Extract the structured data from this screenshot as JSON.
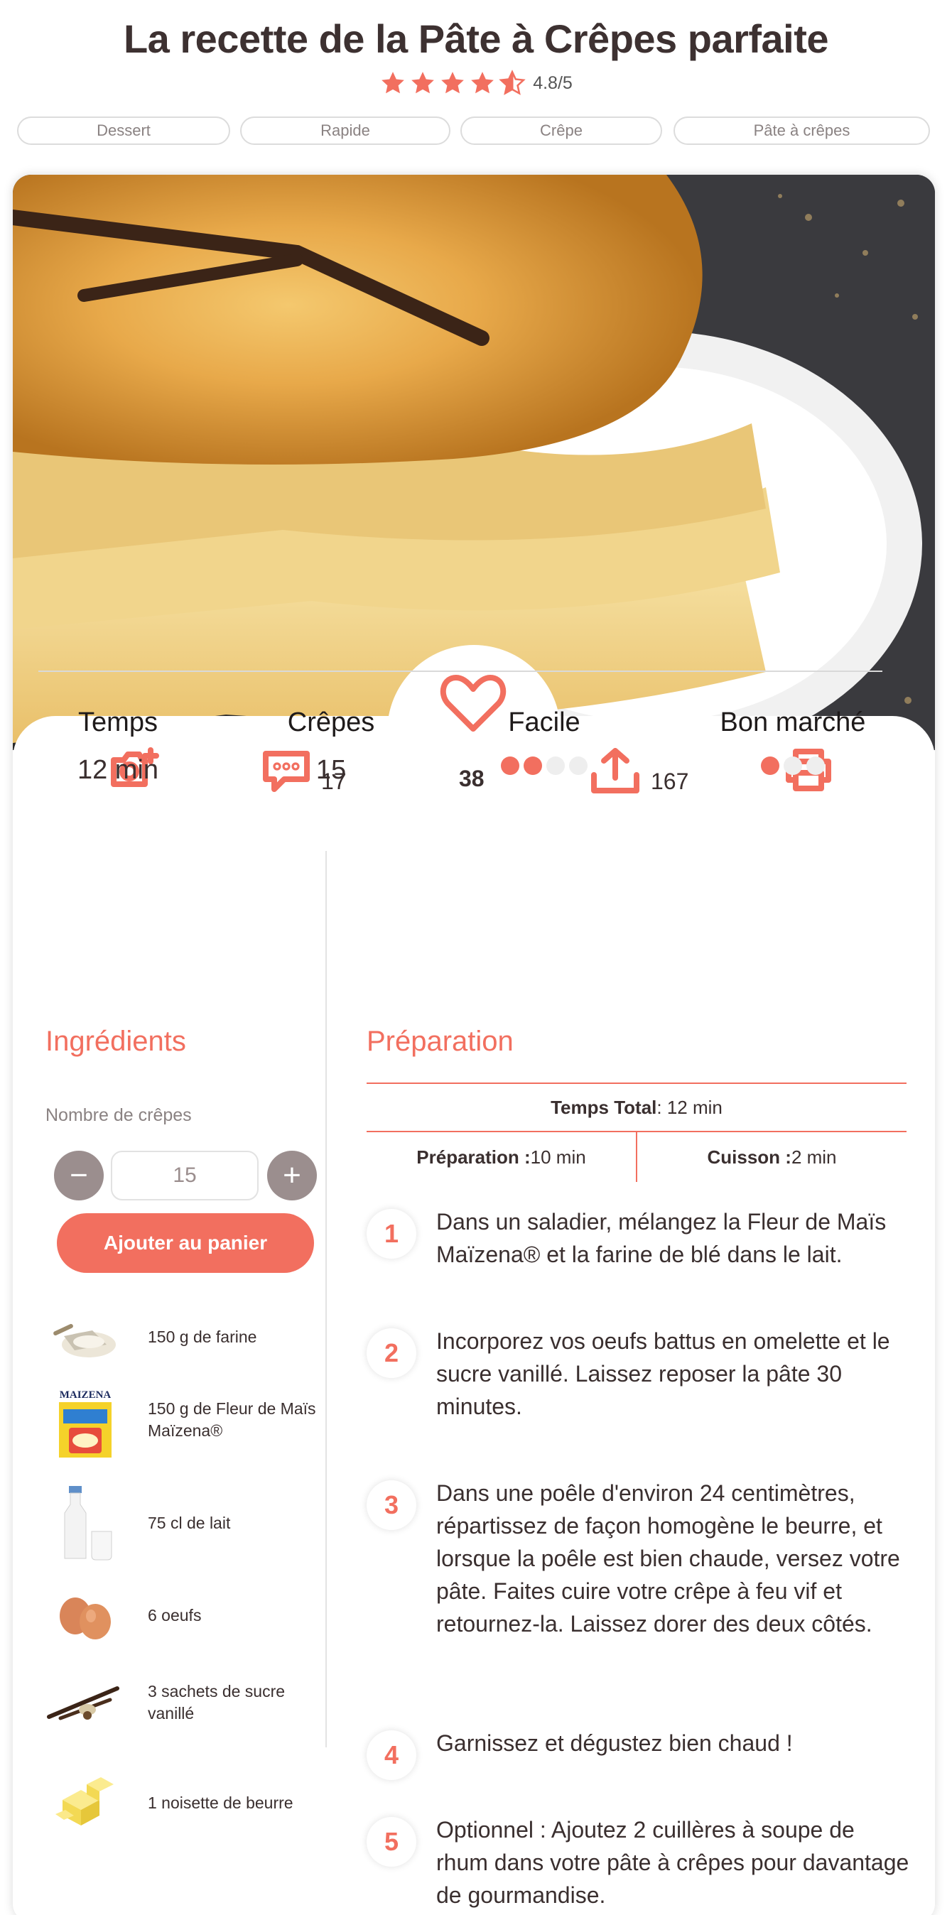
{
  "header": {
    "title": "La recette de la Pâte à Crêpes parfaite",
    "rating": 4.8,
    "rating_text": "4.8/5"
  },
  "tags": [
    "Dessert",
    "Rapide",
    "Crêpe",
    "Pâte à crêpes"
  ],
  "actions": {
    "comments_count": "17",
    "likes_count": "38",
    "shares_count": "167"
  },
  "stats": {
    "time_label": "Temps",
    "time_value": "12 min",
    "yield_label": "Crêpes",
    "yield_value": "15",
    "difficulty_label": "Facile",
    "difficulty_level": "2/4",
    "cost_label": "Bon marché",
    "cost_level": "1/3"
  },
  "ingredients": {
    "title": "Ingrédients",
    "servings_label": "Nombre de crêpes",
    "servings_value": "15",
    "minus": "−",
    "plus": "+",
    "cart_button": "Ajouter au panier",
    "items": [
      {
        "text": "150 g de farine",
        "icon": "flour-scoop-icon"
      },
      {
        "text": "150 g de Fleur de Maïs Maïzena®",
        "icon": "maizena-box-icon"
      },
      {
        "text": "75 cl de lait",
        "icon": "milk-bottle-icon"
      },
      {
        "text": "6 oeufs",
        "icon": "eggs-icon"
      },
      {
        "text": "3 sachets de sucre vanillé",
        "icon": "vanilla-sugar-icon"
      },
      {
        "text": "1 noisette de beurre",
        "icon": "butter-icon"
      }
    ]
  },
  "preparation": {
    "title": "Préparation",
    "total_label": "Temps Total",
    "total_value": " : 12 min",
    "prep_label": "Préparation :",
    "prep_value": " 10 min",
    "cook_label": "Cuisson :",
    "cook_value": " 2 min",
    "steps": [
      {
        "n": "1",
        "text": "Dans un saladier, mélangez la Fleur de Maïs Maïzena® et la farine de blé dans le lait."
      },
      {
        "n": "2",
        "text": "Incorporez vos oeufs battus en omelette et le sucre vanillé. Laissez reposer la pâte 30 minutes."
      },
      {
        "n": "3",
        "text": "Dans une poêle d'environ 24 centimètres, répartissez de façon homogène le beurre, et lorsque la poêle est bien chaude, versez votre pâte. Faites cuire votre crêpe à feu vif et retournez-la. Laissez dorer des deux côtés."
      },
      {
        "n": "4",
        "text": "Garnissez et dégustez bien chaud !"
      },
      {
        "n": "5",
        "text": "Optionnel : Ajoutez 2 cuillères à soupe de rhum dans votre pâte à crêpes pour davantage de gourmandise."
      }
    ]
  },
  "colors": {
    "accent": "#f26f5f",
    "text": "#3a2f2f",
    "muted": "#8a8282"
  }
}
